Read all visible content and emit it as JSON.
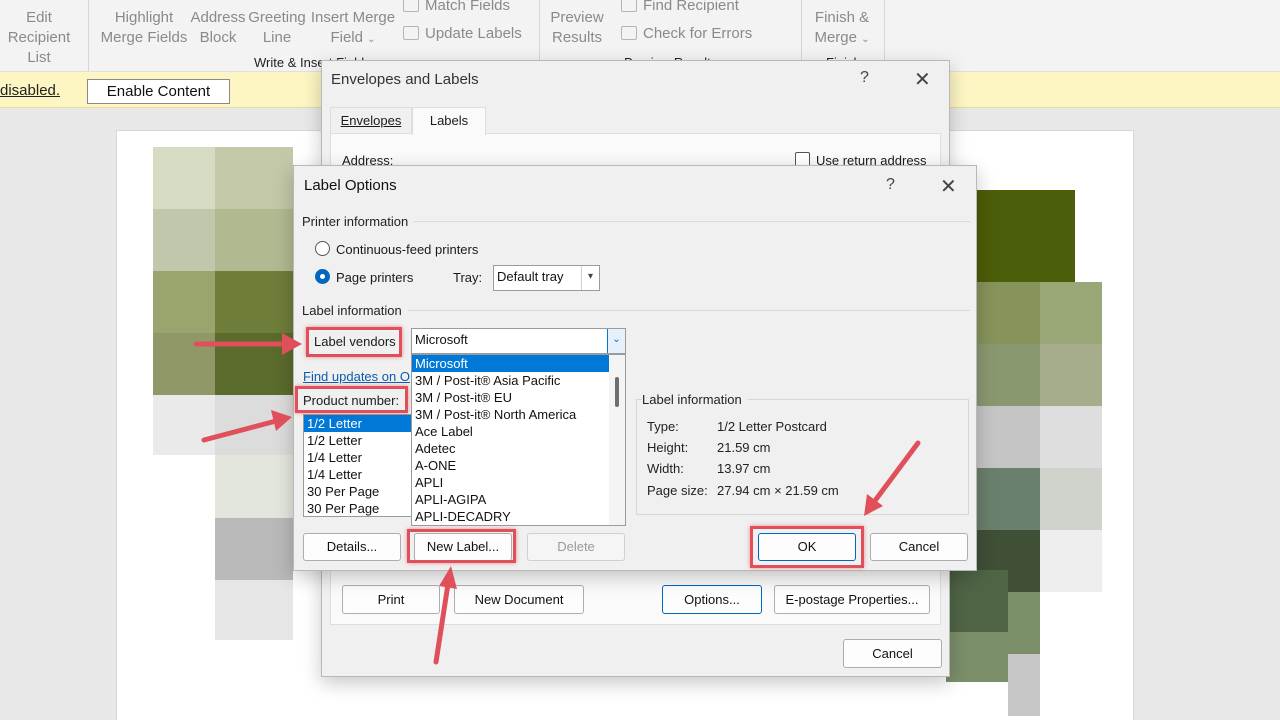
{
  "ribbon": {
    "edit_recipient_list": [
      "Edit",
      "Recipient List"
    ],
    "highlight_merge_fields": [
      "Highlight",
      "Merge Fields"
    ],
    "address_block": [
      "Address",
      "Block"
    ],
    "greeting_line": [
      "Greeting",
      "Line"
    ],
    "insert_merge_field": [
      "Insert Merge",
      "Field"
    ],
    "match_fields": "Match Fields",
    "update_labels": "Update Labels",
    "group_write_insert": "Write & Insert Fields",
    "preview_results": [
      "Preview",
      "Results"
    ],
    "find_recipient": "Find Recipient",
    "check_for_errors": "Check for Errors",
    "group_preview": "Preview Results",
    "finish_merge": [
      "Finish &",
      "Merge"
    ],
    "group_finish": "Finish"
  },
  "message_bar": {
    "text": "disabled.",
    "button": "Enable Content"
  },
  "envelopes_dialog": {
    "title": "Envelopes and Labels",
    "help": "?",
    "close": "✕",
    "tabs": [
      "Envelopes",
      "Labels"
    ],
    "address_label": "Address:",
    "use_return_address": "Use return address",
    "buttons": {
      "print": "Print",
      "new_document": "New Document",
      "options": "Options...",
      "epostage": "E-postage Properties...",
      "cancel": "Cancel"
    }
  },
  "label_options": {
    "title": "Label Options",
    "help": "?",
    "close": "✕",
    "printer_information": "Printer information",
    "continuous_feed": "Continuous-feed printers",
    "page_printers": "Page printers",
    "tray_label": "Tray:",
    "tray_value": "Default tray",
    "label_information": "Label information",
    "label_vendors": "Label vendors",
    "vendor_value": "Microsoft",
    "vendor_options": [
      "Microsoft",
      "3M / Post-it®   Asia Pacific",
      "3M / Post-it®   EU",
      "3M / Post-it®   North America",
      "Ace Label",
      "Adetec",
      "A-ONE",
      "APLI",
      "APLI-AGIPA",
      "APLI-DECADRY"
    ],
    "find_updates": "Find updates on O",
    "product_number": "Product number:",
    "products": [
      "1/2 Letter",
      "1/2 Letter",
      "1/4 Letter",
      "1/4 Letter",
      "30 Per Page",
      "30 Per Page"
    ],
    "info_box": {
      "title": "Label information",
      "rows": [
        {
          "label": "Type:",
          "value": "1/2 Letter Postcard"
        },
        {
          "label": "Height:",
          "value": "21.59 cm"
        },
        {
          "label": "Width:",
          "value": "13.97 cm"
        },
        {
          "label": "Page size:",
          "value": "27.94 cm × 21.59 cm"
        }
      ]
    },
    "buttons": {
      "details": "Details...",
      "new_label": "New Label...",
      "delete": "Delete",
      "ok": "OK",
      "cancel": "Cancel"
    }
  },
  "colors": {
    "highlight": "#e0505a",
    "accent": "#0078d7",
    "message_bar": "#fdf6c3"
  }
}
